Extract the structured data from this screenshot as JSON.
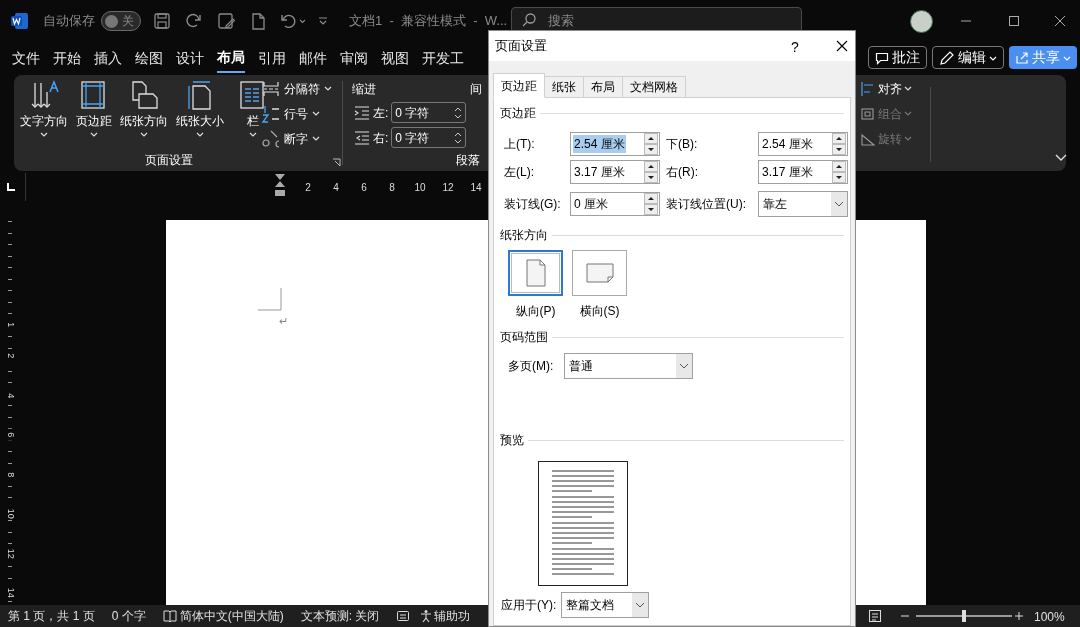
{
  "titlebar": {
    "autosave_label": "自动保存",
    "autosave": {
      "on": false,
      "label": "关"
    },
    "doc_title": "文档1  -  兼容性模式  -  W...",
    "search": {
      "placeholder": "搜索"
    }
  },
  "menu_tabs": [
    {
      "label": "文件",
      "selected": false
    },
    {
      "label": "开始",
      "selected": false
    },
    {
      "label": "插入",
      "selected": false
    },
    {
      "label": "绘图",
      "selected": false
    },
    {
      "label": "设计",
      "selected": false
    },
    {
      "label": "布局",
      "selected": true
    },
    {
      "label": "引用",
      "selected": false
    },
    {
      "label": "邮件",
      "selected": false
    },
    {
      "label": "审阅",
      "selected": false
    },
    {
      "label": "视图",
      "selected": false
    },
    {
      "label": "开发工",
      "selected": false
    }
  ],
  "header_buttons": [
    {
      "kind": "comment",
      "label": "批注"
    },
    {
      "kind": "edit",
      "label": "编辑"
    },
    {
      "kind": "share",
      "label": "共享"
    }
  ],
  "ribbon": {
    "big_buttons": [
      {
        "kind": "text_direction",
        "label": "文字方向"
      },
      {
        "kind": "margins",
        "label": "页边距"
      },
      {
        "kind": "orientation",
        "label": "纸张方向"
      },
      {
        "kind": "size",
        "label": "纸张大小"
      },
      {
        "kind": "columns",
        "label": "栏"
      }
    ],
    "small_buttons": [
      {
        "kind": "breaks",
        "label": "分隔符"
      },
      {
        "kind": "line_numbers",
        "label": "行号"
      },
      {
        "kind": "hyphenation",
        "label": "断字"
      }
    ],
    "page_setup_label": "页面设置",
    "indent": {
      "title": "缩进",
      "rows": [
        {
          "kind": "left",
          "label": "左:",
          "value": "0 字符"
        },
        {
          "kind": "right",
          "label": "右:",
          "value": "0 字符"
        }
      ]
    },
    "spacing_title": "间",
    "paragraph_label": "段落",
    "arrange": [
      {
        "kind": "align",
        "label": "对齐",
        "disabled": false
      },
      {
        "kind": "group",
        "label": "组合",
        "disabled": true
      },
      {
        "kind": "rotate",
        "label": "旋转",
        "disabled": true
      }
    ]
  },
  "ruler": {
    "h_numbers": [
      "2",
      "4",
      "6",
      "8",
      "10",
      "12",
      "14"
    ],
    "v_numbers": [
      "1",
      "2",
      "4",
      "6",
      "8",
      "10",
      "12",
      "14"
    ]
  },
  "document": {
    "paragraph_mark": "↵"
  },
  "status_bar": {
    "items": [
      {
        "kind": "text",
        "label": "第 1 页，共 1 页"
      },
      {
        "kind": "text",
        "label": "0 个字"
      },
      {
        "kind": "language",
        "label": "简体中文(中国大陆)"
      },
      {
        "kind": "text",
        "label": "文本预测: 关闭"
      },
      {
        "kind": "accessibility",
        "label": "辅助功"
      }
    ],
    "zoom": {
      "level": 0.5,
      "label": "100%"
    }
  },
  "dialog": {
    "title": "页面设置",
    "help": "?",
    "tabs": [
      {
        "label": "页边距",
        "selected": true
      },
      {
        "label": "纸张",
        "selected": false
      },
      {
        "label": "布局",
        "selected": false
      },
      {
        "label": "文档网格",
        "selected": false
      }
    ],
    "margins_section": "页边距",
    "margins": [
      {
        "label": "上(T):",
        "value": "2.54 厘米",
        "selected": true
      },
      {
        "label": "下(B):",
        "value": "2.54 厘米",
        "selected": false
      },
      {
        "label": "左(L):",
        "value": "3.17 厘米",
        "selected": false
      },
      {
        "label": "右(R):",
        "value": "3.17 厘米",
        "selected": false
      }
    ],
    "gutter": {
      "label": "装订线(G):",
      "value": "0 厘米"
    },
    "gutter_position": {
      "label": "装订线位置(U):",
      "value": "靠左"
    },
    "orientation_section": "纸张方向",
    "orientations": [
      {
        "kind": "portrait",
        "label": "纵向(P)",
        "selected": true
      },
      {
        "kind": "landscape",
        "label": "横向(S)",
        "selected": false
      }
    ],
    "pages_section": "页码范围",
    "multiple_pages": {
      "label": "多页(M):",
      "value": "普通"
    },
    "preview_section": "预览",
    "apply_to": {
      "label": "应用于(Y):",
      "value": "整篇文档"
    }
  }
}
